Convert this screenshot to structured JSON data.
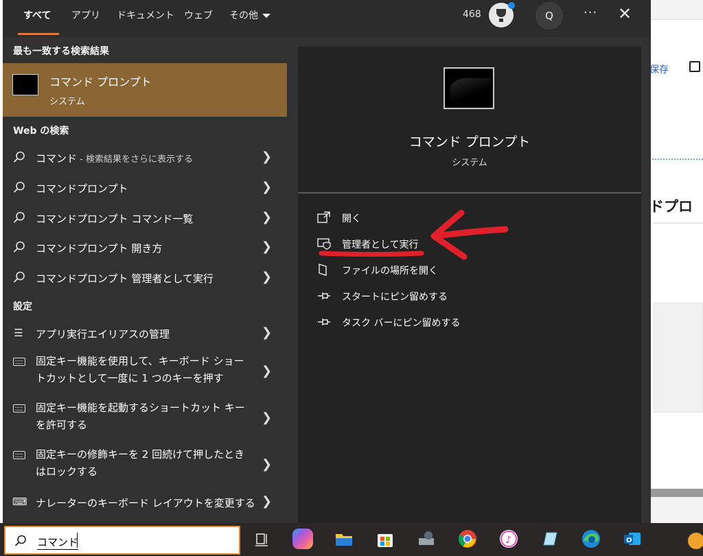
{
  "tabs": [
    {
      "label": "すべて"
    },
    {
      "label": "アプリ"
    },
    {
      "label": "ドキュメント"
    },
    {
      "label": "ウェブ"
    },
    {
      "label": "その他"
    }
  ],
  "header": {
    "points": "468",
    "avatar": "Q",
    "more": "···",
    "close": "✕"
  },
  "best_match": {
    "heading": "最も一致する検索結果",
    "title": "コマンド プロンプト",
    "subtitle": "システム"
  },
  "web": {
    "heading": "Web の検索",
    "items": [
      {
        "main": "コマンド",
        "hint": " - 検索結果をさらに表示する"
      },
      {
        "main": "コマンドプロンプト",
        "hint": ""
      },
      {
        "main": "コマンドプロンプト コマンド一覧",
        "hint": ""
      },
      {
        "main": "コマンドプロンプト 開き方",
        "hint": ""
      },
      {
        "main": "コマンドプロンプト 管理者として実行",
        "hint": ""
      }
    ]
  },
  "settings": {
    "heading": "設定",
    "items": [
      {
        "label": "アプリ実行エイリアスの管理",
        "icon": "list-icon"
      },
      {
        "label": "固定キー機能を使用して、キーボード ショートカットとして一度に 1 つのキーを押す",
        "icon": "keyboard-icon"
      },
      {
        "label": "固定キー機能を起動するショートカット キーを許可する",
        "icon": "keyboard-icon"
      },
      {
        "label": "固定キーの修飾キーを 2 回続けて押したときはロックする",
        "icon": "keyboard-icon"
      },
      {
        "label": "ナレーターのキーボード レイアウトを変更する",
        "icon": "narrator-icon"
      }
    ]
  },
  "detail": {
    "title": "コマンド プロンプト",
    "subtitle": "システム",
    "actions": [
      {
        "label": "開く",
        "icon": "open-icon"
      },
      {
        "label": "管理者として実行",
        "icon": "shield-icon"
      },
      {
        "label": "ファイルの場所を開く",
        "icon": "file-location-icon"
      },
      {
        "label": "スタートにピン留めする",
        "icon": "pin-icon"
      },
      {
        "label": "タスク バーにピン留めする",
        "icon": "pin-icon"
      }
    ]
  },
  "background_page": {
    "save_label": "保存",
    "heading": "ドプロ"
  },
  "taskbar": {
    "search_value": "コマンド",
    "apps": [
      "task-view-icon",
      "copilot-icon",
      "file-explorer-icon",
      "microsoft-store-icon",
      "settings-app-icon",
      "chrome-icon",
      "itunes-icon",
      "notepad-app-icon",
      "edge-icon",
      "outlook-icon"
    ]
  },
  "colors": {
    "accent": "#dd7a3b",
    "selected": "#8a6634",
    "annotation": "#e0202a"
  }
}
